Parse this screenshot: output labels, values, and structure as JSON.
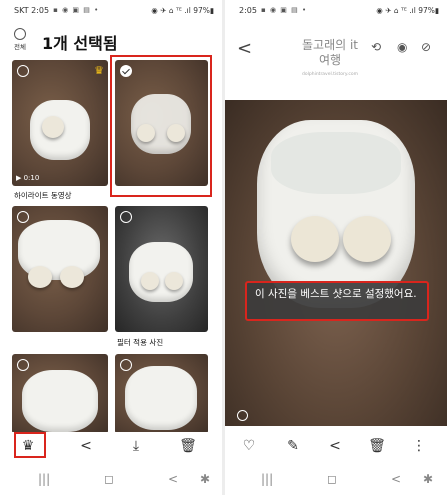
{
  "left": {
    "status": {
      "carrier": "SKT",
      "time": "2:05",
      "icons": "▪ ◉ ▣ ▤ •",
      "right": "◉ ✈ ⌂ ᵀᴱ .ıl 97%▮"
    },
    "select_all_label": "전체",
    "title": "1개 선택됨",
    "thumb1_duration": "▶ 0:10",
    "thumb1_caption": "하이라이트 동영상",
    "thumb4_caption": "필터 적용 사진",
    "toolbar": {
      "crown": "♛",
      "share": "<",
      "download": "⤓",
      "delete": "🗑"
    },
    "nav": {
      "recents": "|||",
      "home": "◻",
      "back": "<",
      "a11y": "✱"
    }
  },
  "right": {
    "status": {
      "time": "2:05",
      "icons": "▪ ◉ ▣ ▤ •",
      "right": "◉ ✈ ⌂ ᵀᴱ .ıl 97%▮"
    },
    "back": "<",
    "title": "돌고래의 it 여행",
    "subtitle": "dolphintravel.tistory.com",
    "header_icons": {
      "remaster": "⟲",
      "view": "◉",
      "motion": "⊘"
    },
    "toast": "이 사진을 베스트 샷으로 설정했어요.",
    "toolbar": {
      "favorite": "♡",
      "edit": "✎",
      "share": "<",
      "delete": "🗑",
      "more": "⋮"
    },
    "nav": {
      "recents": "|||",
      "home": "◻",
      "back": "<",
      "a11y": "✱"
    }
  },
  "colors": {
    "highlight": "#d9251d",
    "crown": "#f6c318"
  }
}
